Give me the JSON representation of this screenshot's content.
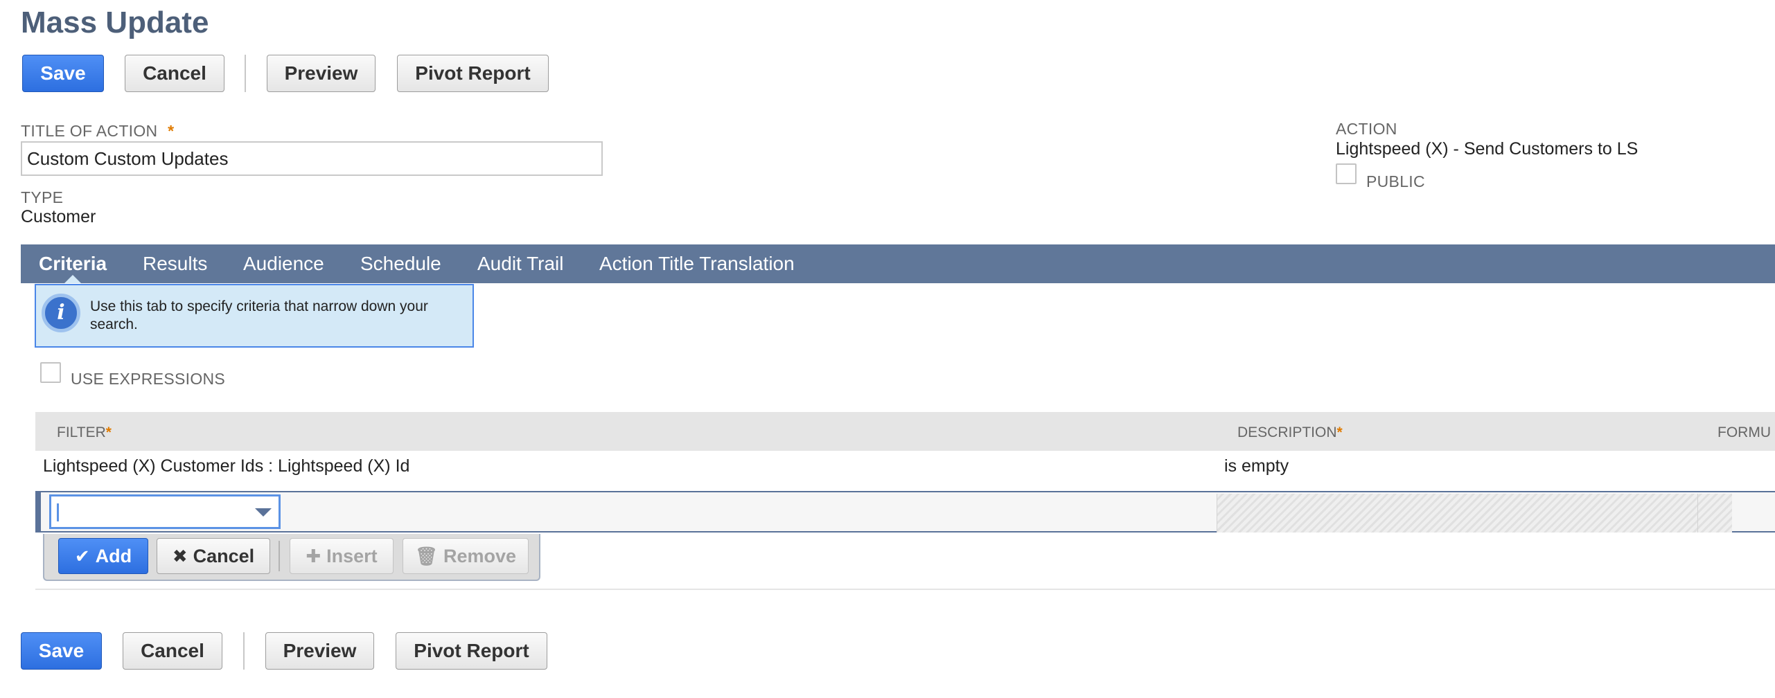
{
  "page": {
    "title": "Mass Update"
  },
  "toolbar": {
    "save": "Save",
    "cancel": "Cancel",
    "preview": "Preview",
    "pivot_report": "Pivot Report"
  },
  "fields": {
    "title_of_action": {
      "label": "TITLE OF ACTION",
      "required_mark": "*",
      "value": "Custom Custom Updates"
    },
    "type": {
      "label": "TYPE",
      "value": "Customer"
    },
    "action": {
      "label": "ACTION",
      "value": "Lightspeed (X) - Send Customers to LS"
    },
    "public": {
      "label": "PUBLIC",
      "checked": false
    }
  },
  "tabs": [
    {
      "label": "Criteria",
      "active": true
    },
    {
      "label": "Results",
      "active": false
    },
    {
      "label": "Audience",
      "active": false
    },
    {
      "label": "Schedule",
      "active": false
    },
    {
      "label": "Audit Trail",
      "active": false
    },
    {
      "label": "Action Title Translation",
      "active": false
    }
  ],
  "info": {
    "icon": "info-icon",
    "text": "Use this tab to specify criteria that narrow down your search."
  },
  "use_expressions": {
    "label": "USE EXPRESSIONS",
    "checked": false
  },
  "criteria_grid": {
    "columns": [
      {
        "label": "FILTER",
        "required_mark": "*"
      },
      {
        "label": "DESCRIPTION",
        "required_mark": "*"
      },
      {
        "label": "FORMU"
      }
    ],
    "rows": [
      {
        "filter": "Lightspeed (X) Customer Ids : Lightspeed (X) Id",
        "description": "is empty"
      }
    ],
    "edit_row": {
      "filter_value": ""
    },
    "machine_buttons": {
      "add": "Add",
      "cancel": "Cancel",
      "insert": "Insert",
      "remove": "Remove"
    }
  },
  "colors": {
    "title": "#4d5f79",
    "primary_button": "#3b7ff0",
    "tab_bar": "#607799",
    "info_bg": "#d4e9f7",
    "required": "#e07b00"
  }
}
